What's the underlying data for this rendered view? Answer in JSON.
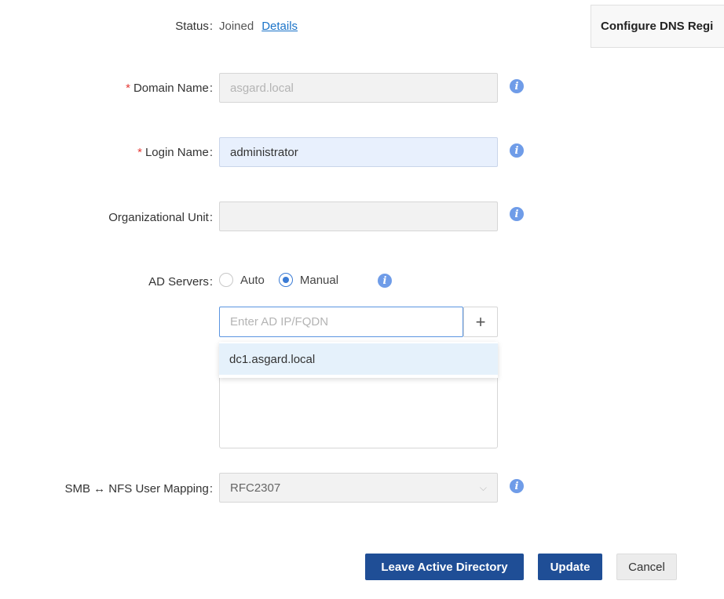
{
  "status": {
    "label": "Status",
    "value": "Joined",
    "details_link": "Details"
  },
  "dns_panel": {
    "title": "Configure DNS Regi"
  },
  "domain_name": {
    "label": "Domain Name",
    "required": "*",
    "value": "asgard.local"
  },
  "login_name": {
    "label": "Login Name",
    "required": "*",
    "value": "administrator"
  },
  "org_unit": {
    "label": "Organizational Unit",
    "value": ""
  },
  "ad_servers": {
    "label": "AD Servers",
    "options": [
      "Auto",
      "Manual"
    ],
    "selected": "Manual",
    "input_placeholder": "Enter AD IP/FQDN",
    "add_symbol": "+",
    "suggestion": "dc1.asgard.local"
  },
  "user_mapping": {
    "label": "SMB ↔ NFS User Mapping",
    "value": "RFC2307",
    "chevron": "⌵"
  },
  "info_glyph": "i",
  "colon": ":",
  "buttons": {
    "leave": "Leave Active Directory",
    "update": "Update",
    "cancel": "Cancel"
  },
  "colors": {
    "primary": "#1f4e96",
    "info": "#6f9ce8",
    "required": "#e53935",
    "link": "#1a73c8",
    "active_border": "#5b95e0"
  }
}
